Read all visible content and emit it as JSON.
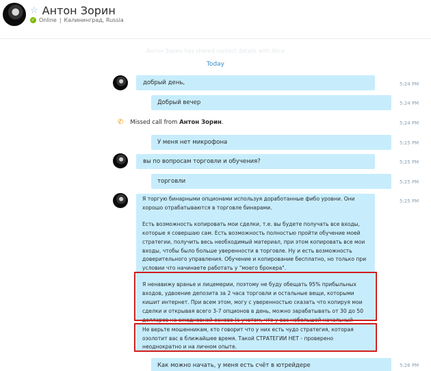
{
  "contact": {
    "name": "Антон Зорин",
    "status": "Online",
    "location": "Калининград, Russia",
    "separator": "|"
  },
  "icons": {
    "favorite": "star-outline-icon",
    "presence": "online-check-icon",
    "missed_call": "phone-icon"
  },
  "conversation": {
    "faded_text": "Антон Зорин has shared contact details with Alice",
    "date_label": "Today"
  },
  "messages": [
    {
      "text": "добрый день,",
      "time": "5:24 PM"
    },
    {
      "text": "Добрый вечер",
      "time": "5:24 PM"
    },
    {
      "missed_prefix": "Missed call from ",
      "missed_name": "Антон Зорин",
      "missed_suffix": ".",
      "time": "5:24 PM"
    },
    {
      "text": "У меня нет микрофона",
      "time": "5:25 PM"
    },
    {
      "text": "вы по вопросам торговли и обучения?",
      "time": "5:25 PM"
    },
    {
      "text": "торговли",
      "time": "5:25 PM"
    },
    {
      "paragraphs": [
        "Я торгую бинарными опционами используя доработанные фибо уровни. Они хорошо отрабатываются в торговле бинарами.",
        "Есть возможность копировать мои сделки, т.е. вы будете получать все входы, которые я совершаю сам. Есть возможность полностью пройти обучение моей стратегии, получить весь необходимый материал, при этом копировать все мои входы, чтобы было больше уверенности в торговле. Ну и есть возможность доверительного управления. Обучение и копирование бесплатно, но только при условии что начинаете работать у \"моего брокера\".",
        "Я ненавижу вранье и лицемерии, поэтому не буду обещать 95% прибыльных входов, удвоение депозита за 2 часа торговли и остальные вещи, которыми кишит интернет. При всем этом, могу с уверенностью сказать что копируя мои сделки и открывая всего 3-7 опционов в день, можно зарабатывать от 30 до 50 долларов на ежедневной основе (с учетом, что у вас небольшой начальный капитал)."
      ],
      "time": "5:25 PM"
    },
    {
      "text": "Не верьте мошенникам, кто говорит что у них есть чудо стратегия, которая озолотит вас в ближайшее время. Такой СТРАТЕГИИ НЕТ - проверено неоднократно и на личном опыте.",
      "time": ""
    },
    {
      "text": "Как можно начать, у меня есть счёт в ютрейдере",
      "time": "5:26 PM"
    }
  ],
  "colors": {
    "incoming_bubble": "#c7edfc",
    "highlight_border": "#d11c1c",
    "link": "#3a8bc7",
    "online": "#7fba00",
    "missed_call": "#f29700"
  }
}
